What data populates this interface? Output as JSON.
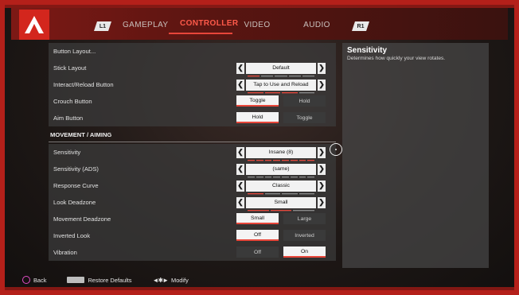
{
  "nav": {
    "left_bumper": "L1",
    "right_bumper": "R1",
    "tabs": [
      "GAMEPLAY",
      "CONTROLLER",
      "VIDEO",
      "AUDIO"
    ],
    "active_tab": "CONTROLLER"
  },
  "settings": {
    "button_layout": "Button Layout...",
    "stick_layout": {
      "label": "Stick Layout",
      "value": "Default",
      "level": 1,
      "steps": 5
    },
    "interact": {
      "label": "Interact/Reload Button",
      "value": "Tap to Use and Reload",
      "level": 3,
      "steps": 4
    },
    "crouch": {
      "label": "Crouch Button",
      "options": [
        "Toggle",
        "Hold"
      ],
      "selected": "Toggle"
    },
    "aim": {
      "label": "Aim Button",
      "options": [
        "Hold",
        "Toggle"
      ],
      "selected": "Hold"
    },
    "section_movement": "MOVEMENT / AIMING",
    "sensitivity": {
      "label": "Sensitivity",
      "value": "Insane  (8)",
      "level": 8,
      "steps": 8
    },
    "sensitivity_ads": {
      "label": "Sensitivity  (ADS)",
      "value": "(same)",
      "level": 0,
      "steps": 8
    },
    "response_curve": {
      "label": "Response Curve",
      "value": "Classic",
      "level": 1,
      "steps": 4
    },
    "look_deadzone": {
      "label": "Look Deadzone",
      "value": "Small",
      "level": 2,
      "steps": 3
    },
    "movement_deadzone": {
      "label": "Movement Deadzone",
      "options": [
        "Small",
        "Large"
      ],
      "selected": "Small"
    },
    "inverted_look": {
      "label": "Inverted Look",
      "options": [
        "Off",
        "Inverted"
      ],
      "selected": "Off"
    },
    "vibration": {
      "label": "Vibration",
      "options": [
        "Off",
        "On"
      ],
      "selected": "On"
    }
  },
  "description": {
    "title": "Sensitivity",
    "text": "Determines how quickly your view rotates."
  },
  "footer": {
    "back": "Back",
    "restore": "Restore Defaults",
    "modify": "Modify"
  },
  "colors": {
    "accent": "#e8463a",
    "frame": "#b4201a",
    "logo": "#d3261d"
  }
}
